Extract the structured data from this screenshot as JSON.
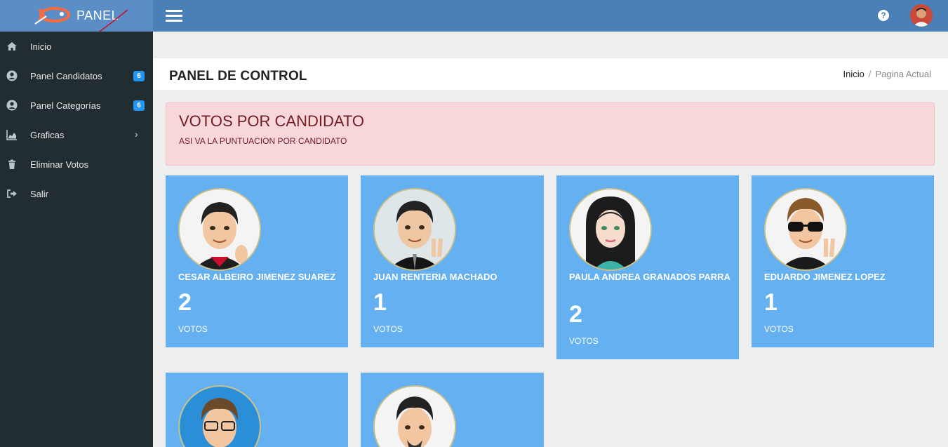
{
  "brand": {
    "name": "PANEL"
  },
  "sidebar": {
    "items": [
      {
        "label": "Inicio",
        "icon": "home-icon"
      },
      {
        "label": "Panel Candidatos",
        "icon": "user-circle-icon",
        "badge": "6"
      },
      {
        "label": "Panel Categorías",
        "icon": "user-circle-icon",
        "badge": "6"
      },
      {
        "label": "Graficas",
        "icon": "area-chart-icon"
      },
      {
        "label": "Eliminar Votos",
        "icon": "trash-icon"
      },
      {
        "label": "Salir",
        "icon": "sign-out-icon"
      }
    ]
  },
  "header": {
    "title": "PANEL DE CONTROL",
    "breadcrumb": {
      "home": "Inicio",
      "separator": "/",
      "current": "Pagina Actual"
    }
  },
  "alert": {
    "title": "VOTOS POR CANDIDATO",
    "subtitle": "ASI VA LA PUNTUACION POR CANDIDATO"
  },
  "candidates": [
    {
      "name": "CESAR ALBEIRO JIMENEZ SUAREZ",
      "votes": "2",
      "unit": "VOTOS"
    },
    {
      "name": "JUAN RENTERIA MACHADO",
      "votes": "1",
      "unit": "VOTOS"
    },
    {
      "name": "PAULA ANDREA GRANADOS PARRA",
      "votes": "2",
      "unit": "VOTOS"
    },
    {
      "name": "EDUARDO JIMENEZ LOPEZ",
      "votes": "1",
      "unit": "VOTOS"
    },
    {
      "name": "",
      "votes": "",
      "unit": ""
    },
    {
      "name": "",
      "votes": "",
      "unit": ""
    }
  ],
  "colors": {
    "topbar": "#4a7fb8",
    "sidebar": "#222d32",
    "card": "#64b0f0",
    "badge": "#2196f3",
    "alert_bg": "#f8d7da",
    "alert_text": "#721c24"
  }
}
